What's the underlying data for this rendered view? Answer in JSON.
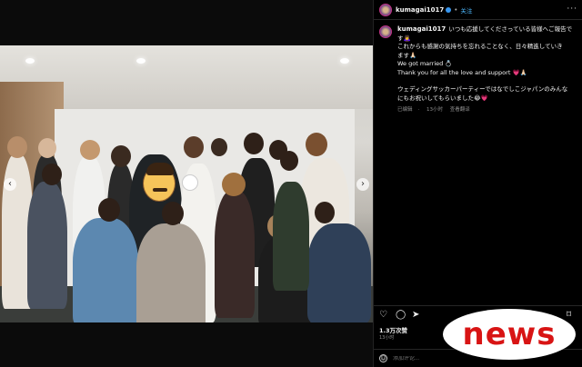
{
  "post": {
    "username": "kumagai1017",
    "follow_label": "关注",
    "more_label": "···",
    "caption_lines": [
      "いつも応援してくださっている皆様へご報告で",
      "す🙇‍♀️",
      "これからも感謝の気持ちを忘れることなく、日々精進していき",
      "ます🙏🏻",
      "We got married 💍",
      "Thank you for all the love and support 💗🙏🏻"
    ],
    "caption_lines2": [
      "ウェディングサッカーパーティーではなでしこジャパンのみんな",
      "にもお祝いしてもらいました😂💗"
    ],
    "caption_meta": {
      "edited": "已编辑",
      "age": "13小时",
      "translate": "查看翻译"
    },
    "likes": "1.3万次赞",
    "time": "13小时",
    "comment_placeholder": "添加评论..."
  },
  "icons": {
    "like": "heart-icon",
    "comment": "comment-icon",
    "share": "share-icon",
    "save": "bookmark-icon",
    "emoji": "emoji-icon"
  },
  "watermark": {
    "text": "news",
    "color": "#d81414"
  }
}
